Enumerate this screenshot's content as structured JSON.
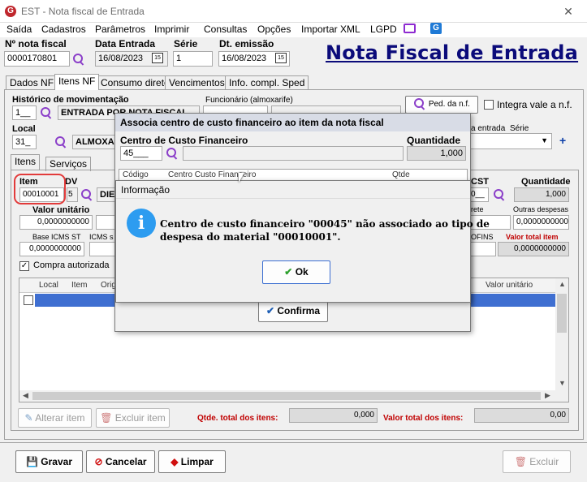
{
  "window": {
    "title": "EST - Nota fiscal de Entrada",
    "close": "✕"
  },
  "menu": [
    "Saída",
    "Cadastros",
    "Parâmetros",
    "Imprimir",
    "Consultas",
    "Opções",
    "Importar XML",
    "LGPD"
  ],
  "header": {
    "nf_label": "Nº nota fiscal",
    "nf_value": "0000170801",
    "data_entrada_label": "Data Entrada",
    "data_entrada_value": "16/08/2023",
    "serie_label": "Série",
    "serie_value": "1",
    "dt_emissao_label": "Dt. emissão",
    "dt_emissao_value": "16/08/2023",
    "big_title": "Nota Fiscal de Entrada",
    "cal_label": "15"
  },
  "tabs": [
    "Dados NF",
    "Itens NF",
    "Consumo direto",
    "Vencimentos",
    "Info. compl. Sped"
  ],
  "itens": {
    "historico_label": "Histórico de movimentação",
    "historico_code": "1__",
    "historico_desc": "ENTRADA POR NOTA FISCAL",
    "funcionario_label": "Funcionário (almoxarife)",
    "ped_nf_label": "Ped. da n.f.",
    "integra_label": "Integra vale a n.f.",
    "local_label": "Local",
    "local_code": "31_",
    "local_desc": "ALMOXA",
    "entrada_label": "a entrada",
    "serie_label": "Série",
    "subtabs": [
      "Itens",
      "Serviços"
    ],
    "item_label": "Item",
    "item_value": "00010001",
    "dv_label": "DV",
    "dv_value": "5",
    "die_value": "DIE",
    "cst_label": "CST",
    "cst_value": "0__",
    "quantidade_label": "Quantidade",
    "quantidade_value": "1,000",
    "valor_unitario_label": "Valor unitário",
    "valor_unitario_value": "0,0000000000",
    "frete_label": "rete",
    "outras_label": "Outras despesas",
    "outras_value": "0,0000000000",
    "base_icms_st_label": "Base ICMS ST",
    "base_icms_st_value": "0,0000000000",
    "icms_s_label": "ICMS s",
    "cofins_label": "OFINS",
    "valor_total_item_label": "Valor total item",
    "valor_total_item_value": "0,0000000000",
    "compra_autorizada_label": "Compra autorizada",
    "grid_headers": [
      "Local",
      "Item",
      "Orig"
    ],
    "grid_header_right": "Valor unitário",
    "alterar_label": "Alterar item",
    "excluir_item_label": "Excluir item",
    "qtde_total_label": "Qtde. total dos itens:",
    "qtde_total_value": "0,000",
    "valor_total_label": "Valor total dos itens:",
    "valor_total_value": "0,00"
  },
  "bottom": {
    "gravar": "Gravar",
    "cancelar": "Cancelar",
    "limpar": "Limpar",
    "excluir": "Excluir"
  },
  "dialog_cc": {
    "title": "Associa centro de custo financeiro ao item da nota fiscal",
    "centro_label": "Centro de Custo Financeiro",
    "centro_value": "45___",
    "quantidade_label": "Quantidade",
    "quantidade_value": "1,000",
    "grid_headers": [
      "Código",
      "Centro Custo Financeiro",
      "Qtde"
    ],
    "confirma_label": "Confirma"
  },
  "dialog_info": {
    "title": "Informação",
    "message_line1": "Centro de custo financeiro \"00045\" não associado ao tipo de",
    "message_line2": "despesa do material \"00010001\".",
    "ok_label": "Ok",
    "icon_letter": "i"
  },
  "colors": {
    "accent_title": "#0b0b7a",
    "info_blue": "#2d9cf0",
    "red_label": "#c00000",
    "mag": "#8b3fc9"
  }
}
